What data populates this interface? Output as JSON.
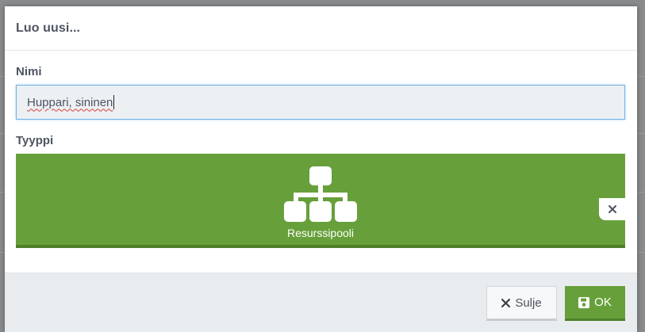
{
  "modal": {
    "title": "Luo uusi..."
  },
  "form": {
    "name_label": "Nimi",
    "name_value": "Huppari, sininen",
    "type_label": "Tyyppi",
    "type_tile": {
      "label": "Resurssipooli",
      "icon": "hierarchy-icon",
      "color": "#67a03a"
    },
    "remove_icon": "close-icon"
  },
  "footer": {
    "close_label": "Sulje",
    "close_icon": "close-icon",
    "ok_label": "OK",
    "ok_icon": "save-icon",
    "ok_color": "#67a03a"
  }
}
